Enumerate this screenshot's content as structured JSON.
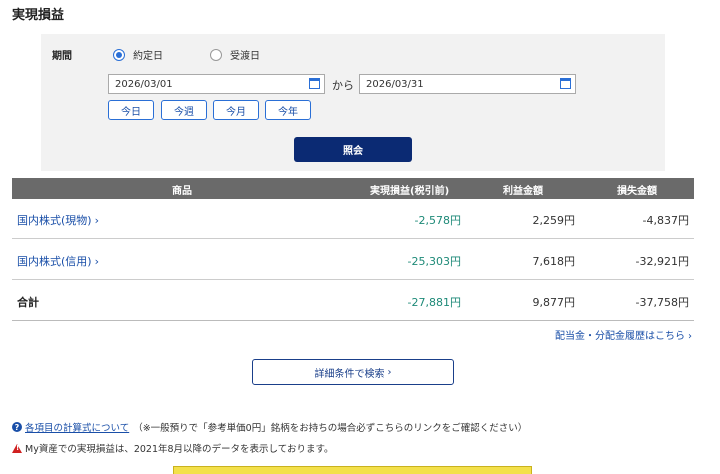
{
  "page": {
    "title": "実現損益"
  },
  "filter": {
    "period_label": "期間",
    "radio_contract": "約定日",
    "radio_delivery": "受渡日",
    "date_from": "2026/03/01",
    "date_to": "2026/03/31",
    "kara": "から",
    "quick": [
      "今日",
      "今週",
      "今月",
      "今年"
    ],
    "search_label": "照会"
  },
  "table": {
    "headers": {
      "product": "商品",
      "net": "実現損益(税引前)",
      "profit": "利益金額",
      "loss": "損失金額"
    },
    "rows": [
      {
        "name": "国内株式(現物)",
        "net": "-2,578円",
        "profit": "2,259円",
        "loss": "-4,837円"
      },
      {
        "name": "国内株式(信用)",
        "net": "-25,303円",
        "profit": "7,618円",
        "loss": "-32,921円"
      }
    ],
    "total": {
      "name": "合計",
      "net": "-27,881円",
      "profit": "9,877円",
      "loss": "-37,758円"
    }
  },
  "links": {
    "dividend": "配当金・分配金履歴はこちら",
    "detail_search": "詳細条件で検索"
  },
  "notes": {
    "formula_link": "各項目の計算式について",
    "formula_note": "（※一般預りで「参考単価0円」銘柄をお持ちの場合必ずこちらのリンクをご確認ください）",
    "data_note": "My資産での実現損益は、2021年8月以降のデータを表示しております。"
  },
  "colors": {
    "accent": "#1a4fa8",
    "primary_button": "#0b2a73",
    "header_bg": "#6a6a6a",
    "negative_net": "#1e8a78",
    "warning": "#d02020"
  }
}
